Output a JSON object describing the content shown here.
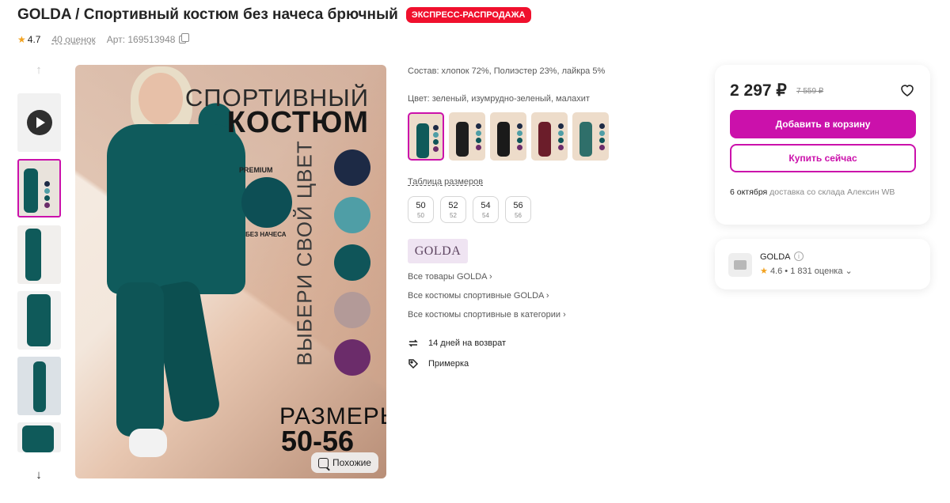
{
  "header": {
    "title": "GOLDA / Спортивный костюм без начеса брючный",
    "badge": "ЭКСПРЕСС-РАСПРОДАЖА",
    "rating": "4.7",
    "reviews": "40 оценок",
    "article": "Арт: 169513948"
  },
  "gallery": {
    "heading_line1": "СПОРТИВНЫЙ",
    "heading_line2": "КОСТЮМ",
    "vertical_text": "ВЫБЕРИ СВОЙ ЦВЕТ",
    "fabric_top": "PREMIUM",
    "fabric_bottom": "БЕЗ НАЧЕСА",
    "sizes_label": "РАЗМЕРЫ",
    "sizes_range": "50-56",
    "similar_label": "Похожие",
    "swatches": [
      "#1d2a45",
      "#4f9ea6",
      "#0f5559",
      "#b39a98",
      "#6b2c6a"
    ]
  },
  "details": {
    "composition": "Состав: хлопок 72%, Полиэстер 23%, лайкра 5%",
    "color_label": "Цвет: зеленый, изумрудно-зеленый, малахит",
    "color_variants": [
      {
        "fig": "#0f5a5a"
      },
      {
        "fig": "#1e1e1e"
      },
      {
        "fig": "#1a1a1a"
      },
      {
        "fig": "#6b1d2a"
      },
      {
        "fig": "#2f6f6a"
      }
    ],
    "size_table": "Таблица размеров",
    "sizes": [
      {
        "size": "50",
        "ru": "50"
      },
      {
        "size": "52",
        "ru": "52"
      },
      {
        "size": "54",
        "ru": "54"
      },
      {
        "size": "56",
        "ru": "56"
      }
    ],
    "brand": "GOLDA",
    "links": [
      "Все товары GOLDA",
      "Все костюмы спортивные GOLDA",
      "Все костюмы спортивные в категории"
    ],
    "return": "14 дней на возврат",
    "fitting": "Примерка"
  },
  "price_card": {
    "price": "2 297 ₽",
    "old_price": "7 559 ₽",
    "add_to_cart": "Добавить в корзину",
    "buy_now": "Купить сейчас",
    "delivery_date": "6 октября",
    "delivery_rest": "доставка со склада Алексин WB"
  },
  "seller": {
    "name": "GOLDA",
    "rating": "4.6",
    "count": "• 1 831 оценка"
  },
  "colors": {
    "accent": "#cb11ab",
    "badge": "#f0102d",
    "star": "#f2a21f"
  }
}
